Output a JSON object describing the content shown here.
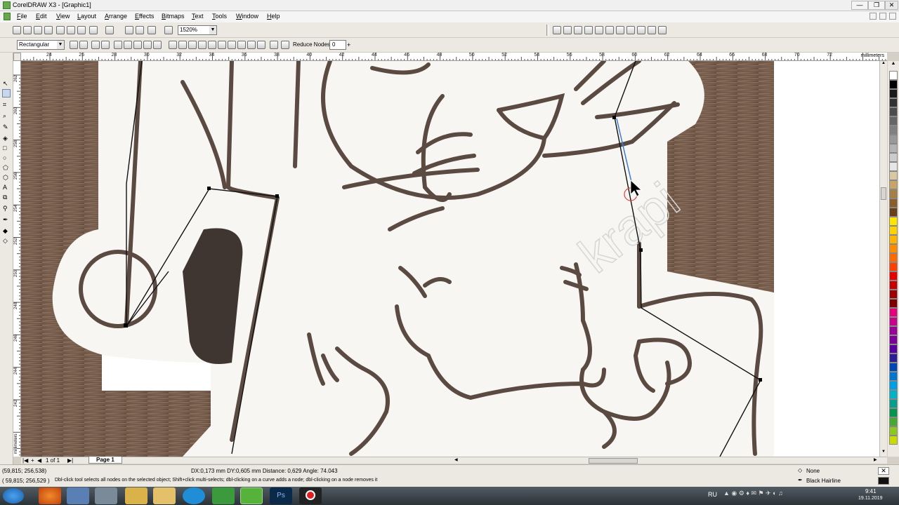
{
  "window": {
    "title": "CorelDRAW X3 - [Graphic1]",
    "buttons": [
      "—",
      "❐",
      "✕"
    ]
  },
  "menu": [
    "File",
    "Edit",
    "View",
    "Layout",
    "Arrange",
    "Effects",
    "Bitmaps",
    "Text",
    "Tools",
    "Window",
    "Help"
  ],
  "toolbar": {
    "zoom_value": "1520%"
  },
  "propbar": {
    "shape_mode": "Rectangular",
    "reduce_nodes_label": "Reduce Nodes",
    "reduce_nodes_value": "0"
  },
  "rulers": {
    "units": "millimeters",
    "h_ticks": [
      "24",
      "26",
      "28",
      "30",
      "32",
      "34",
      "36",
      "38",
      "40",
      "42",
      "44",
      "46",
      "48",
      "50",
      "52",
      "54",
      "56",
      "58",
      "60",
      "62",
      "64",
      "66",
      "68",
      "70",
      "72"
    ],
    "v_ticks": [
      "262",
      "260",
      "258",
      "256",
      "254",
      "252",
      "250",
      "248",
      "246",
      "244",
      "242"
    ]
  },
  "pages": {
    "counter": "1 of 1",
    "tab": "Page 1"
  },
  "status": {
    "coord1": "(59,815; 256,538)",
    "coord2": "( 59,815; 256,529 )",
    "measure": "DX:0,173 mm DY:0,605 mm Distance: 0,629 Angle: 74.043",
    "hint": "Dbl-click tool selects all nodes on the selected object; Shift+click multi-selects; dbl-clicking on a curve adds a node; dbl-clicking on a node removes it",
    "fill": "None",
    "outline": "Black  Hairline"
  },
  "canvas": {
    "watermark": "krapi"
  },
  "palette_colors": [
    "#ffffff",
    "#000000",
    "#1a1a1a",
    "#333333",
    "#4d4d4d",
    "#666666",
    "#808080",
    "#999999",
    "#b3b3b3",
    "#cccccc",
    "#e6e6e6",
    "#d9c9a3",
    "#c8a46a",
    "#a57f43",
    "#8b5e2b",
    "#6b3f1a",
    "#ffe600",
    "#ffd200",
    "#ffb400",
    "#ff8c00",
    "#ff6a00",
    "#ff4000",
    "#e60000",
    "#c80000",
    "#a00000",
    "#800000",
    "#e6007e",
    "#c8008c",
    "#9b0096",
    "#7d009b",
    "#5a00a0",
    "#2d1e96",
    "#0046b4",
    "#0078d2",
    "#00a0e6",
    "#00b4c8",
    "#00a08c",
    "#009650",
    "#46aa32",
    "#8cc81e",
    "#c8dc00"
  ],
  "taskbar": {
    "lang": "RU",
    "time": "9:41",
    "date": "19.11.2019"
  }
}
